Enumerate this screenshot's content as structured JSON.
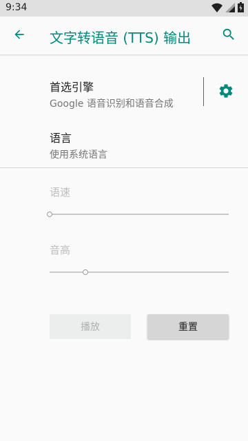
{
  "status_bar": {
    "time": "9:34"
  },
  "app_bar": {
    "title": "文字转语音 (TTS) 输出"
  },
  "preferred_engine": {
    "title": "首选引擎",
    "summary": "Google 语音识别和语音合成"
  },
  "language": {
    "title": "语言",
    "summary": "使用系统语言"
  },
  "speech_rate": {
    "label": "语速",
    "value": 0.0
  },
  "pitch": {
    "label": "音高",
    "value": 0.2
  },
  "buttons": {
    "play": "播放",
    "reset": "重置"
  },
  "colors": {
    "accent": "#00897b",
    "background": "#fafafa",
    "status_bar": "#e0e0e0"
  },
  "icons": [
    "wifi-icon",
    "cellular-signal-icon",
    "battery-icon",
    "back-arrow-icon",
    "search-icon",
    "gear-icon"
  ]
}
